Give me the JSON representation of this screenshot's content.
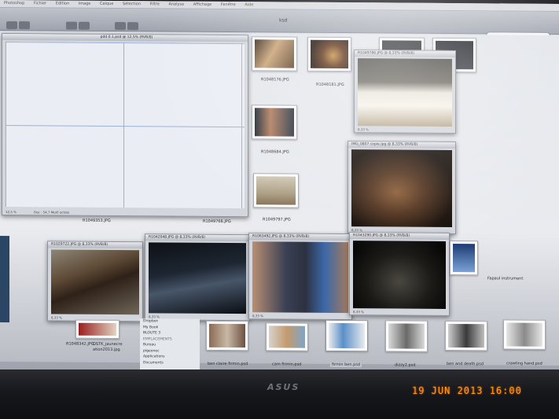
{
  "menu": {
    "app": "Photoshop",
    "items": [
      "Fichier",
      "Edition",
      "Image",
      "Calque",
      "Sélection",
      "Filtre",
      "Analyse",
      "Affichage",
      "Fenêtre",
      "Aide"
    ]
  },
  "finder": {
    "folder_title": "ksd"
  },
  "main_doc": {
    "title": "pdd 0.1.psd @ 12,5% (RVB/8)",
    "zoom": "12,5 %",
    "doc_info": "Doc : 54,7 Mo/0 octets"
  },
  "thumbnails": [
    {
      "caption": "R1048176.JPG"
    },
    {
      "caption": "R1048181.JPG"
    },
    {
      "caption": "R1048684.JPG"
    },
    {
      "caption": "R1049797.JPG"
    },
    {
      "caption": "R1049353.JPG"
    },
    {
      "caption": "R1049768.JPG"
    },
    {
      "caption": "R1048342.JPG"
    },
    {
      "caption": "OSTK_jaunecre ation2013.jpg"
    }
  ],
  "windows": [
    {
      "title": "R1049786.JPG @ 8,33% (RVB/8)",
      "zoom": "8,33 %"
    },
    {
      "title": "IMG_0807 copie.jpg @ 8,33% (RVB/8)",
      "zoom": "8,33 %"
    },
    {
      "title": "R1029722.JPG @ 8,33% (RVB/8)",
      "zoom": "8,33 %"
    },
    {
      "title": "R1042048.JPG @ 8,33% (RVB/8)",
      "zoom": "8,33 %"
    },
    {
      "title": "R1063492.JPG @ 8,33% (RVB/8)",
      "zoom": "8,33 %"
    },
    {
      "title": "R1043290.JPG @ 8,33% (RVB/8)",
      "zoom": "8,33 %"
    }
  ],
  "sidebar": {
    "items": [
      "Dropbox",
      "My Book",
      "BLOUTE 3",
      "EMPLACEMENTS",
      "Bureau",
      "pigeonec",
      "Applications",
      "Documents"
    ]
  },
  "files": [
    {
      "caption": "ben claire firmin.psd"
    },
    {
      "caption": "cam firmin.psd"
    },
    {
      "caption": "firmin ben.psd"
    },
    {
      "caption": "dizzy2.psd"
    },
    {
      "caption": "ben and death.psd"
    },
    {
      "caption": "crawling hand.psd"
    }
  ],
  "folder_right": {
    "caption": "Fapaul instrument"
  },
  "bezel": {
    "brand": "ASUS"
  },
  "timestamp": "19 JUN 2013 16:00"
}
